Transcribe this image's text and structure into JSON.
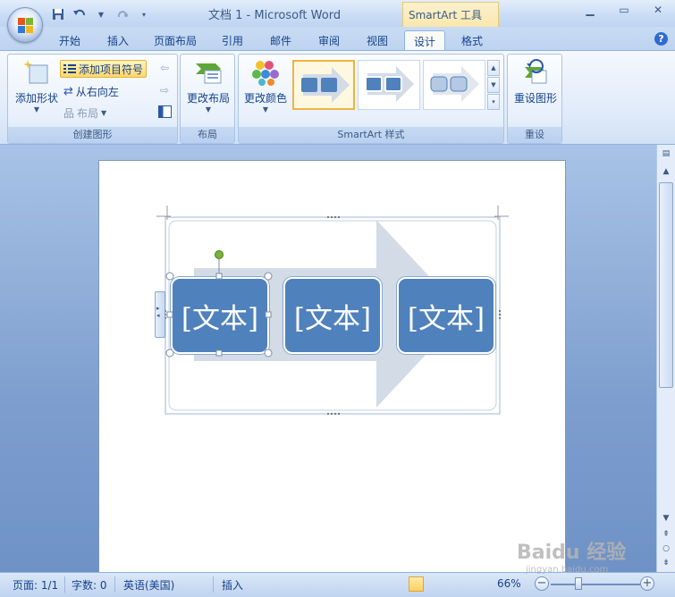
{
  "titlebar": {
    "title": "文档 1 - Microsoft Word",
    "tools_header": "SmartArt 工具",
    "quick_access": [
      "save-icon",
      "undo-icon",
      "redo-icon",
      "customize-icon"
    ]
  },
  "tabs": [
    {
      "label": "开始",
      "active": false
    },
    {
      "label": "插入",
      "active": false
    },
    {
      "label": "页面布局",
      "active": false
    },
    {
      "label": "引用",
      "active": false
    },
    {
      "label": "邮件",
      "active": false
    },
    {
      "label": "审阅",
      "active": false
    },
    {
      "label": "视图",
      "active": false
    },
    {
      "label": "设计",
      "active": true
    },
    {
      "label": "格式",
      "active": false
    }
  ],
  "ribbon": {
    "create_group": {
      "label": "创建图形",
      "add_shape": "添加形状",
      "add_bullet": "添加项目符号",
      "right_to_left": "从右向左",
      "layout": "布局"
    },
    "layout_group": {
      "label": "布局",
      "change_layout": "更改布局"
    },
    "styles_group": {
      "label": "SmartArt 样式",
      "change_colors": "更改颜色"
    },
    "reset_group": {
      "label": "重设",
      "reset_graphic": "重设图形"
    }
  },
  "smartart": {
    "boxes": [
      "[文本]",
      "[文本]",
      "[文本]"
    ]
  },
  "statusbar": {
    "page": "页面: 1/1",
    "words": "字数: 0",
    "language": "英语(美国)",
    "mode": "插入",
    "zoom": "66%",
    "zoom_minus": "−",
    "zoom_plus": "+"
  },
  "watermark": {
    "brand": "Baidu 经验",
    "url": "jingyan.baidu.com"
  },
  "colors": {
    "box_fill": "#4f81bd",
    "arrow_fill": "#d3dbe6",
    "selection_handle": "#79b33a"
  }
}
